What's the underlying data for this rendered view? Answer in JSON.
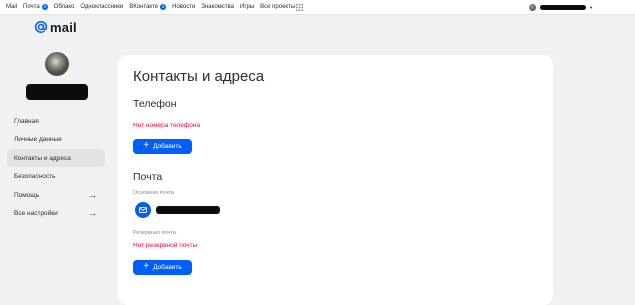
{
  "topnav": {
    "items": [
      {
        "label": "Mail",
        "badge": null
      },
      {
        "label": "Почта",
        "badge": "4"
      },
      {
        "label": "Облако",
        "badge": null
      },
      {
        "label": "Одноклассники",
        "badge": null
      },
      {
        "label": "ВКонтакте",
        "badge": "3"
      },
      {
        "label": "Новости",
        "badge": null
      },
      {
        "label": "Знакомства",
        "badge": null
      },
      {
        "label": "Игры",
        "badge": null
      },
      {
        "label": "Все проекты",
        "badge": null
      }
    ],
    "user_caret": "▼"
  },
  "logo": {
    "text": "mail"
  },
  "sidebar": {
    "items": [
      {
        "label": "Главная",
        "arrow": ""
      },
      {
        "label": "Личные данные",
        "arrow": ""
      },
      {
        "label": "Контакты и адреса",
        "arrow": ""
      },
      {
        "label": "Безопасность",
        "arrow": ""
      },
      {
        "label": "Помощь",
        "arrow": "→"
      },
      {
        "label": "Все настройки",
        "arrow": "→"
      }
    ],
    "active_index": 2
  },
  "main": {
    "title": "Контакты и адреса",
    "phone": {
      "title": "Телефон",
      "empty_text": "Нет номера телефона",
      "add_label": "Добавить"
    },
    "mail": {
      "title": "Почта",
      "primary_label": "Основная почта",
      "backup_label": "Резервная почта",
      "backup_empty_text": "Нет резервной почты",
      "add_label": "Добавить"
    }
  },
  "colors": {
    "accent": "#005ff9",
    "warning": "#ed0a34",
    "background": "#f0f1f3",
    "card": "#ffffff",
    "active_item": "#e2e3e6"
  },
  "icons": {
    "apps": "grid-icon",
    "logo": "at-sign-icon",
    "mail": "envelope-icon",
    "add": "plus-icon",
    "arrow": "arrow-right-icon"
  }
}
